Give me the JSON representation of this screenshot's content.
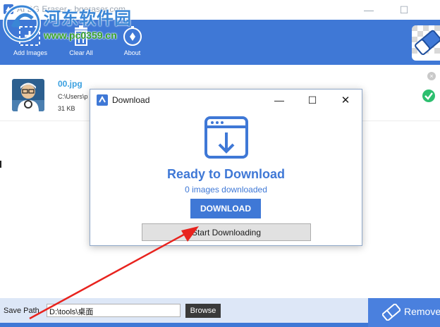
{
  "window": {
    "title": "AI BG Eraser - bgeraser.com",
    "minimize_glyph": "—",
    "maximize_glyph": "☐"
  },
  "watermark": {
    "line1": "河东软件园",
    "line2": "www.pc0359.cn"
  },
  "toolbar": {
    "add_images_label": "Add Images",
    "clear_all_label": "Clear All",
    "about_label": "About"
  },
  "image_list": [
    {
      "file_name": "00.jpg",
      "path": "C:\\Users\\p",
      "size": "31 KB",
      "status": "done"
    }
  ],
  "dialog": {
    "title": "Download",
    "minimize_glyph": "—",
    "maximize_glyph": "☐",
    "close_glyph": "✕",
    "heading": "Ready to Download",
    "subtext": "0 images downloaded",
    "download_button": "DOWNLOAD",
    "start_button": "Start Downloading"
  },
  "bottom_bar": {
    "save_path_label": "Save Path",
    "save_path_value": "D:\\tools\\桌面",
    "browse_label": "Browse",
    "remove_label": "Remove"
  },
  "colors": {
    "accent": "#3f78d6",
    "annotation_arrow": "#e8231e",
    "success": "#2dbf6f"
  }
}
